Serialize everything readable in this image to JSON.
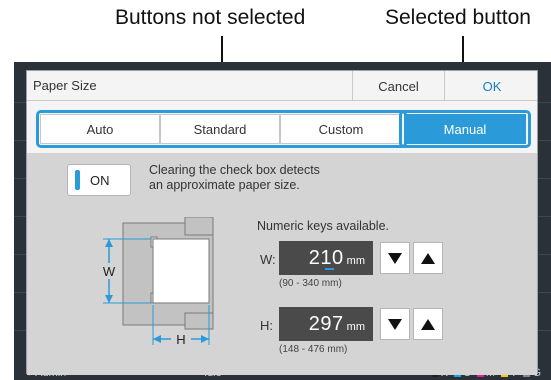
{
  "annotations": {
    "not_selected": "Buttons not selected",
    "selected": "Selected button"
  },
  "dialog": {
    "title": "Paper Size",
    "cancel_label": "Cancel",
    "ok_label": "OK"
  },
  "tabs": {
    "items": [
      {
        "label": "Auto",
        "selected": false
      },
      {
        "label": "Standard",
        "selected": false
      },
      {
        "label": "Custom",
        "selected": false
      },
      {
        "label": "Manual",
        "selected": true
      }
    ]
  },
  "check": {
    "label": "ON",
    "checked": true,
    "description_line1": "Clearing the check box detects",
    "description_line2": "an approximate paper size."
  },
  "illustration": {
    "w_label": "W",
    "h_label": "H"
  },
  "numeric": {
    "hint": "Numeric keys available.",
    "width": {
      "label": "W:",
      "value": "210",
      "unit": "mm",
      "range": "(90 - 340 mm)"
    },
    "height": {
      "label": "H:",
      "value": "297",
      "unit": "mm",
      "range": "(148 - 476 mm)"
    }
  },
  "status_bar": {
    "user": "Admin",
    "state": "Idle",
    "toner": [
      {
        "label": "K",
        "color": "#222222"
      },
      {
        "label": "C",
        "color": "#1aa0e0"
      },
      {
        "label": "M",
        "color": "#e0208a"
      },
      {
        "label": "Y",
        "color": "#f0d000"
      },
      {
        "label": "G",
        "color": "#888888"
      }
    ]
  },
  "colors": {
    "accent": "#2a9bd8",
    "field_bg": "#4a4a4a",
    "screen_bg": "#2b3138"
  }
}
